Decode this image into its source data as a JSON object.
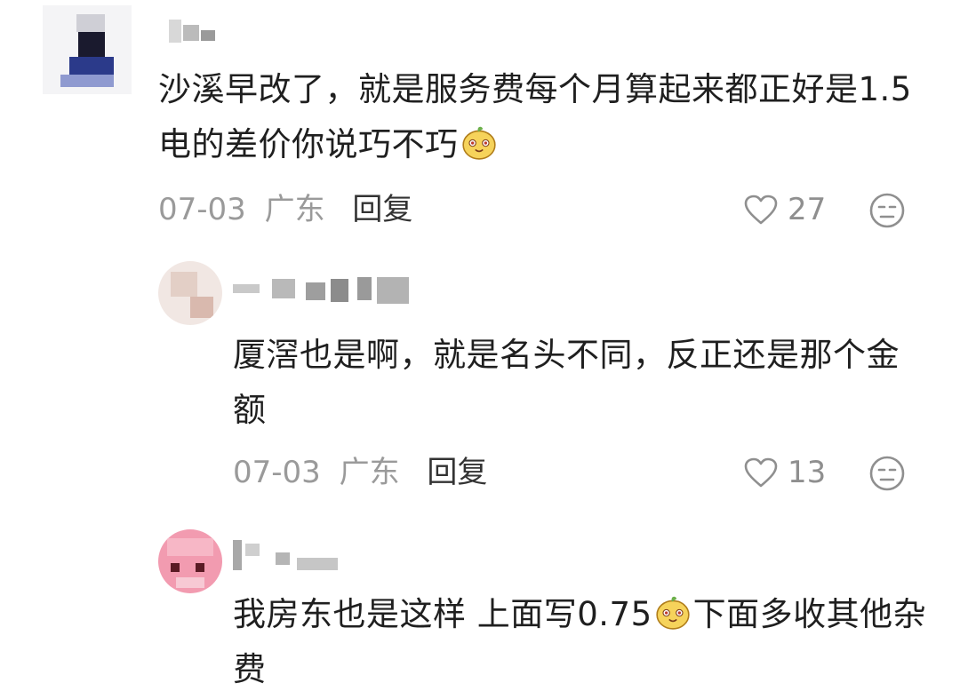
{
  "comments": [
    {
      "text": "沙溪早改了，就是服务费每个月算起来都正好是1.5电的差价你说巧不巧",
      "date": "07-03",
      "location": "广东",
      "reply_label": "回复",
      "likes": "27"
    },
    {
      "text": "厦滘也是啊，就是名头不同，反正还是那个金额",
      "date": "07-03",
      "location": "广东",
      "reply_label": "回复",
      "likes": "13"
    },
    {
      "text_part1": "我房东也是这样 上面写0.75",
      "text_part2": "下面多收其他杂费"
    }
  ],
  "icons": {
    "like": "heart-outline-icon",
    "dislike": "dislike-face-icon",
    "emoji": "smiling-mango-emoji"
  },
  "colors": {
    "meta": "#9a9a9a",
    "text": "#1f1f1f",
    "icon": "#8f8f8f"
  }
}
